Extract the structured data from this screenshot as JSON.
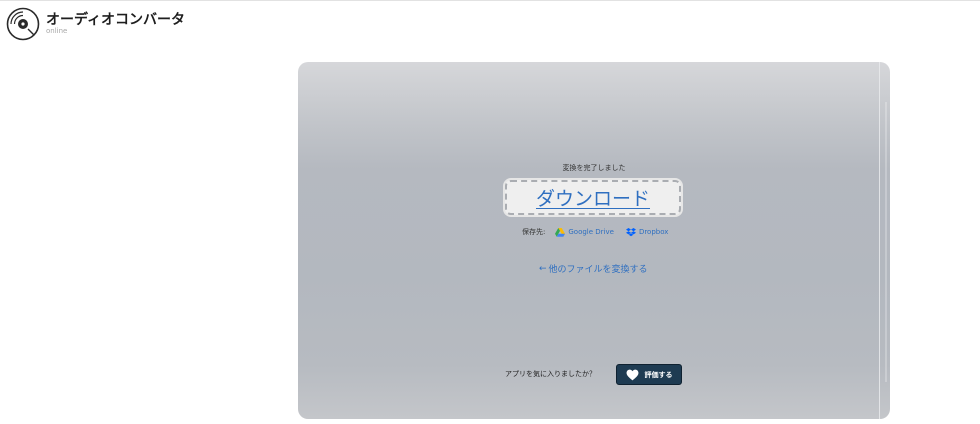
{
  "header": {
    "title": "オーディオコンバータ",
    "subtitle": "online"
  },
  "result": {
    "done_text": "変換を完了しました",
    "download_label": "ダウンロード",
    "save_to_label": "保存先:",
    "google_drive": "Google Drive",
    "dropbox": "Dropbox",
    "back_arrow": "←",
    "back_link": "他のファイルを変換する"
  },
  "rating": {
    "question": "アプリを気に入りましたか？",
    "button_label": "評価する"
  },
  "colors": {
    "link": "#2f6fc0",
    "rate_button": "#1e3b52"
  }
}
